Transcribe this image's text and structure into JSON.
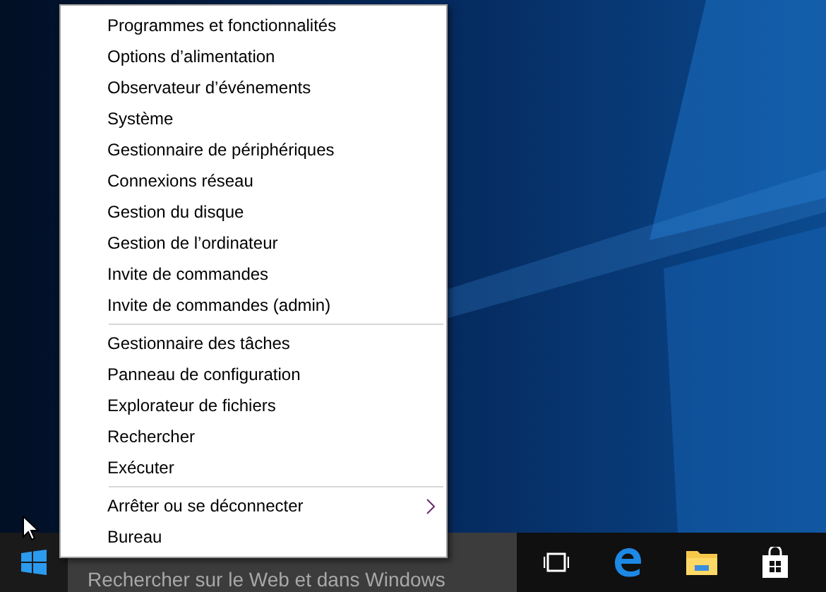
{
  "context_menu": {
    "groups": [
      {
        "items": [
          {
            "label": "Programmes et fonctionnalités",
            "has_submenu": false
          },
          {
            "label": "Options d’alimentation",
            "has_submenu": false
          },
          {
            "label": "Observateur d’événements",
            "has_submenu": false
          },
          {
            "label": "Système",
            "has_submenu": false
          },
          {
            "label": "Gestionnaire de périphériques",
            "has_submenu": false
          },
          {
            "label": "Connexions réseau",
            "has_submenu": false
          },
          {
            "label": "Gestion du disque",
            "has_submenu": false
          },
          {
            "label": "Gestion de l’ordinateur",
            "has_submenu": false
          },
          {
            "label": "Invite de commandes",
            "has_submenu": false
          },
          {
            "label": "Invite de commandes (admin)",
            "has_submenu": false
          }
        ]
      },
      {
        "items": [
          {
            "label": "Gestionnaire des tâches",
            "has_submenu": false
          },
          {
            "label": "Panneau de configuration",
            "has_submenu": false
          },
          {
            "label": "Explorateur de fichiers",
            "has_submenu": false
          },
          {
            "label": "Rechercher",
            "has_submenu": false
          },
          {
            "label": "Exécuter",
            "has_submenu": false
          }
        ]
      },
      {
        "items": [
          {
            "label": "Arrêter ou se déconnecter",
            "has_submenu": true
          },
          {
            "label": "Bureau",
            "has_submenu": false
          }
        ]
      }
    ]
  },
  "taskbar": {
    "search": {
      "placeholder": "Rechercher sur le Web et dans Windows"
    }
  }
}
